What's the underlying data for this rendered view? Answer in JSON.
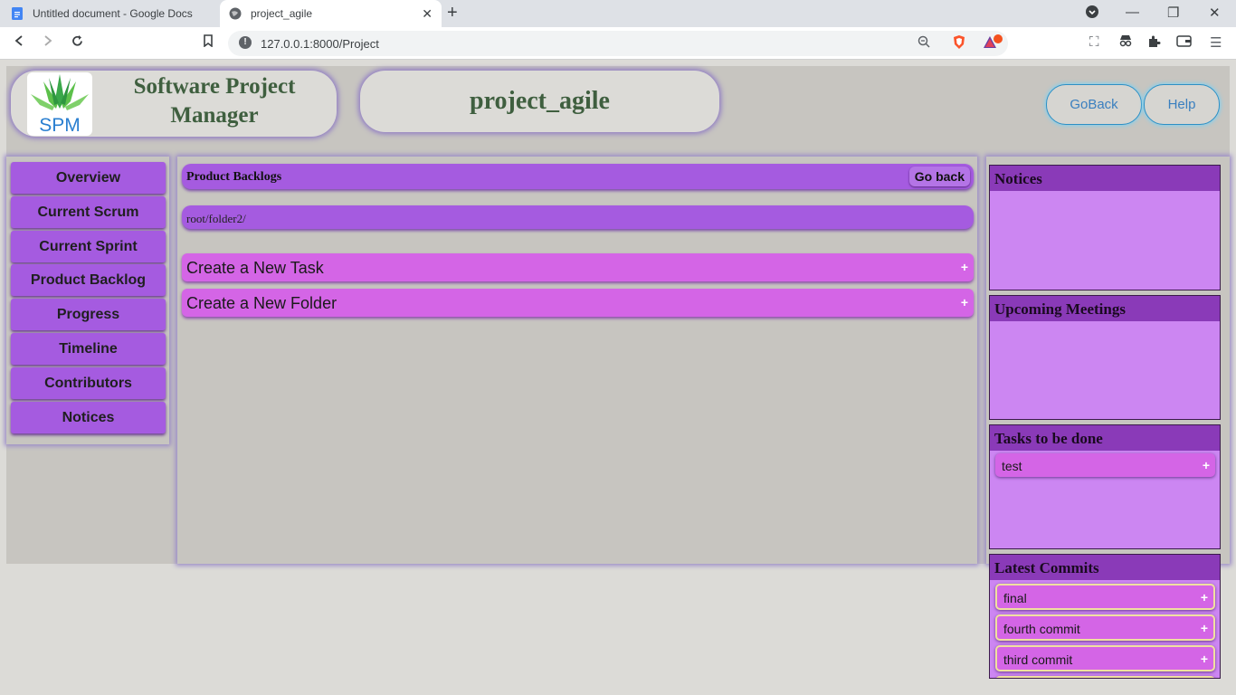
{
  "browser": {
    "tabs": [
      {
        "title": "Untitled document - Google Docs",
        "active": false
      },
      {
        "title": "project_agile",
        "active": true
      }
    ],
    "url": "127.0.0.1:8000/Project"
  },
  "header": {
    "logo_text": "SPM",
    "app_title": "Software Project Manager",
    "project_name": "project_agile",
    "goback_label": "GoBack",
    "help_label": "Help"
  },
  "sidebar": {
    "items": [
      {
        "label": "Overview"
      },
      {
        "label": "Current Scrum"
      },
      {
        "label": "Current Sprint"
      },
      {
        "label": "Product Backlog"
      },
      {
        "label": "Progress"
      },
      {
        "label": "Timeline"
      },
      {
        "label": "Contributors"
      },
      {
        "label": "Notices"
      }
    ]
  },
  "main": {
    "section_title": "Product Backlogs",
    "go_back_label": "Go back",
    "path": "root/folder2/",
    "actions": [
      {
        "label": "Create a New Task"
      },
      {
        "label": "Create a New Folder"
      }
    ]
  },
  "right": {
    "notices_title": "Notices",
    "meetings_title": "Upcoming Meetings",
    "tasks_title": "Tasks to be done",
    "tasks": [
      {
        "label": "test"
      }
    ],
    "commits_title": "Latest Commits",
    "commits": [
      {
        "label": "final"
      },
      {
        "label": "fourth commit"
      },
      {
        "label": "third commit"
      }
    ]
  },
  "colors": {
    "sidebar_button": "#a55be0",
    "action_bar": "#d465e6",
    "card_header": "#8a3ab8",
    "card_body": "#cc86f2",
    "page_bg": "#c7c5c0"
  }
}
